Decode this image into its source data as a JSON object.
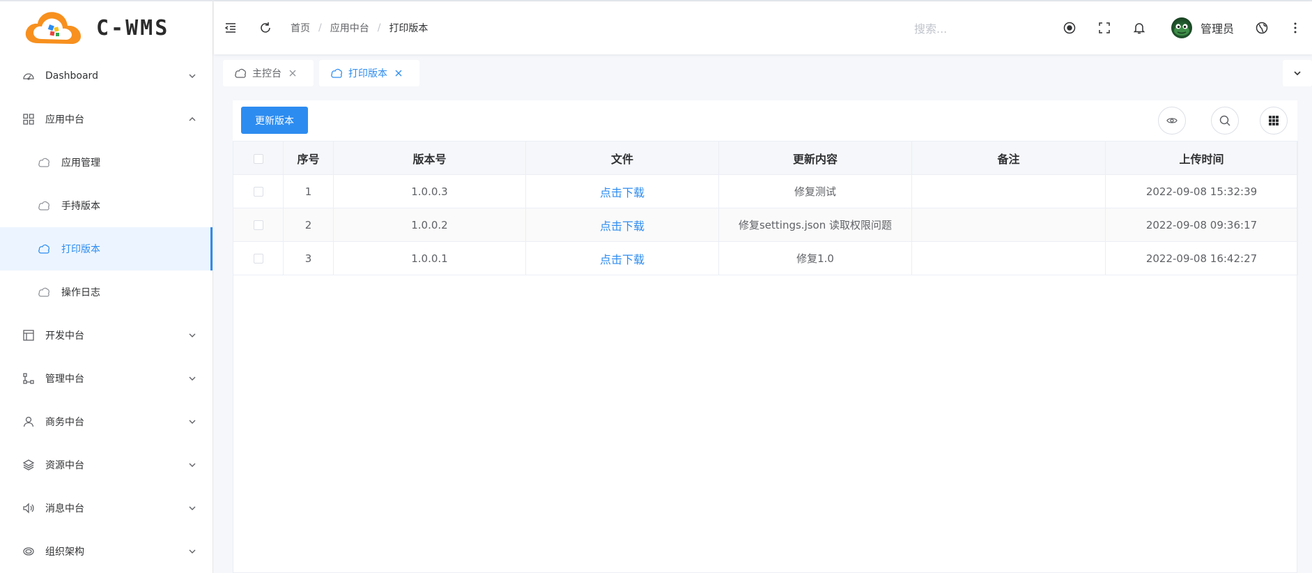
{
  "app": {
    "logo_text": "C-WMS"
  },
  "sidebar": {
    "items": [
      {
        "label": "Dashboard",
        "icon": "dashboard-icon"
      },
      {
        "label": "应用中台",
        "icon": "grid-icon",
        "children": [
          {
            "label": "应用管理"
          },
          {
            "label": "手持版本"
          },
          {
            "label": "打印版本"
          },
          {
            "label": "操作日志"
          }
        ]
      },
      {
        "label": "开发中台",
        "icon": "layout-icon"
      },
      {
        "label": "管理中台",
        "icon": "share-icon"
      },
      {
        "label": "商务中台",
        "icon": "user-icon"
      },
      {
        "label": "资源中台",
        "icon": "layers-icon"
      },
      {
        "label": "消息中台",
        "icon": "speaker-icon"
      },
      {
        "label": "组织架构",
        "icon": "org-icon"
      }
    ]
  },
  "header": {
    "breadcrumb": [
      "首页",
      "应用中台",
      "打印版本"
    ],
    "search_placeholder": "搜索...",
    "user_name": "管理员"
  },
  "tabs": [
    {
      "label": "主控台",
      "active": false
    },
    {
      "label": "打印版本",
      "active": true
    }
  ],
  "toolbar": {
    "update_button": "更新版本"
  },
  "table": {
    "columns": [
      "序号",
      "版本号",
      "文件",
      "更新内容",
      "备注",
      "上传时间"
    ],
    "rows": [
      {
        "index": "1",
        "version": "1.0.0.3",
        "file": "点击下载",
        "content": "修复测试",
        "remark": "",
        "time": "2022-09-08 15:32:39"
      },
      {
        "index": "2",
        "version": "1.0.0.2",
        "file": "点击下载",
        "content": "修复settings.json 读取权限问题",
        "remark": "",
        "time": "2022-09-08 09:36:17"
      },
      {
        "index": "3",
        "version": "1.0.0.1",
        "file": "点击下载",
        "content": "修复1.0",
        "remark": "",
        "time": "2022-09-08 16:42:27"
      }
    ]
  },
  "colors": {
    "primary": "#2d8cf0",
    "active_bg": "#ecf5ff",
    "logo_orange": "#f7901e"
  }
}
